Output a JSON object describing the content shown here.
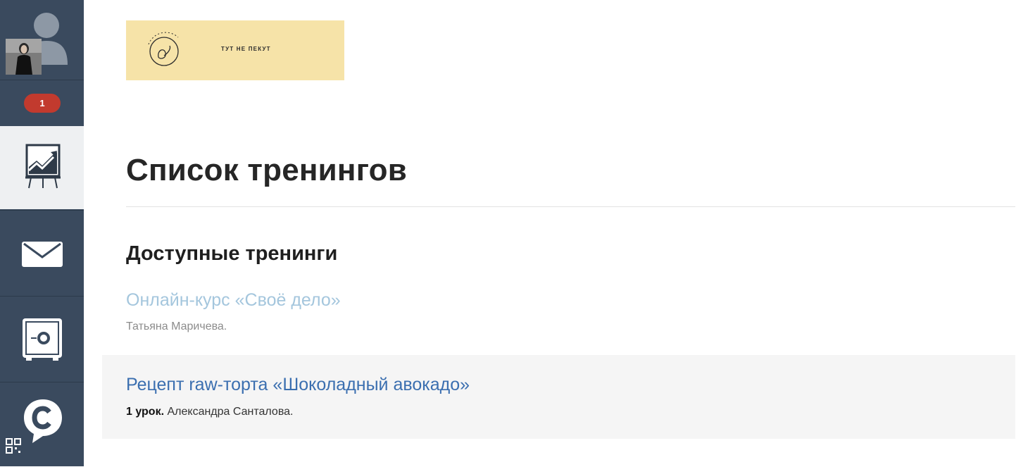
{
  "sidebar": {
    "notification_count": "1",
    "items": [
      {
        "name": "trainings",
        "icon": "chart-easel-icon",
        "active": true
      },
      {
        "name": "messages",
        "icon": "envelope-icon",
        "active": false
      },
      {
        "name": "safe",
        "icon": "safe-icon",
        "active": false
      },
      {
        "name": "chat",
        "icon": "chat-bubble-icon",
        "active": false
      }
    ],
    "qr_icon": "qr-code-icon"
  },
  "banner": {
    "text": "ТУТ НЕ ПЕКУТ",
    "background": "#f6e3a8"
  },
  "page": {
    "title": "Список тренингов",
    "section_title": "Доступные тренинги"
  },
  "courses": [
    {
      "title": "Онлайн-курс «Своё дело»",
      "lessons": "",
      "author": "Татьяна Маричева."
    },
    {
      "title": "Рецепт raw-торта «Шоколадный авокадо»",
      "lessons": "1 урок.",
      "author": "Александра Санталова."
    }
  ],
  "colors": {
    "sidebar_bg": "#3a4a5e",
    "badge": "#c23a2e",
    "link_active": "#3b6fb0",
    "link_muted": "#a4c6dd"
  }
}
